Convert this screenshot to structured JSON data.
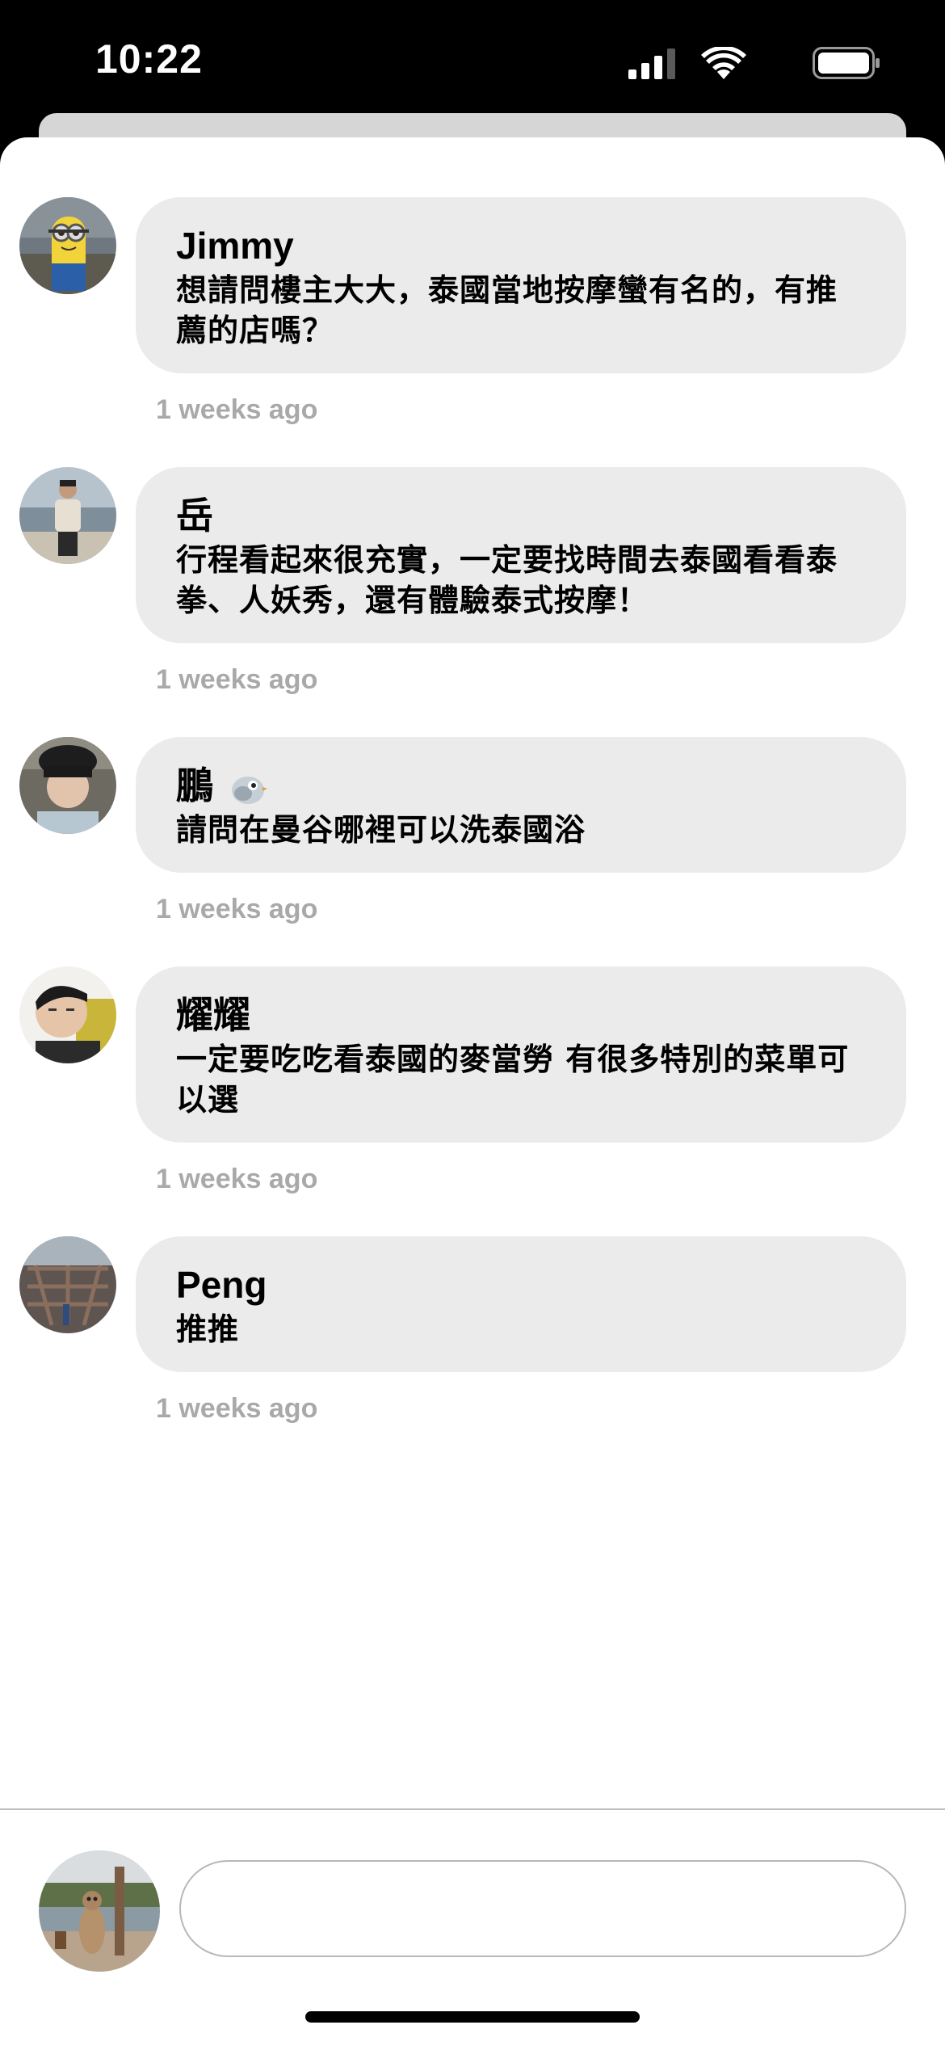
{
  "status_bar": {
    "time": "10:22",
    "icons": [
      "signal-icon",
      "wifi-icon",
      "battery-icon"
    ]
  },
  "comments": [
    {
      "author": "Jimmy",
      "text": "想請問樓主大大，泰國當地按摩蠻有名的，有推薦的店嗎？",
      "time": "1 weeks ago",
      "avatar": "minion-figure-avatar"
    },
    {
      "author": "岳",
      "text": "行程看起來很充實，一定要找時間去泰國看看泰拳、人妖秀，還有體驗泰式按摩！",
      "time": "1 weeks ago",
      "avatar": "beach-portrait-avatar"
    },
    {
      "author": "鵬",
      "author_emoji": "bird-emoji",
      "text": "請問在曼谷哪裡可以洗泰國浴",
      "time": "1 weeks ago",
      "avatar": "cap-portrait-avatar"
    },
    {
      "author": "耀耀",
      "text": "一定要吃吃看泰國的麥當勞 有很多特別的菜單可以選",
      "time": "1 weeks ago",
      "avatar": "face-portrait-avatar"
    },
    {
      "author": "Peng",
      "text": "推推",
      "time": "1 weeks ago",
      "avatar": "architecture-avatar"
    }
  ],
  "composer": {
    "avatar": "meerkat-avatar",
    "input_value": "",
    "input_placeholder": ""
  },
  "colors": {
    "bubble": "#ebebeb",
    "timestamp": "#a9a9a9",
    "background": "#ffffff"
  }
}
